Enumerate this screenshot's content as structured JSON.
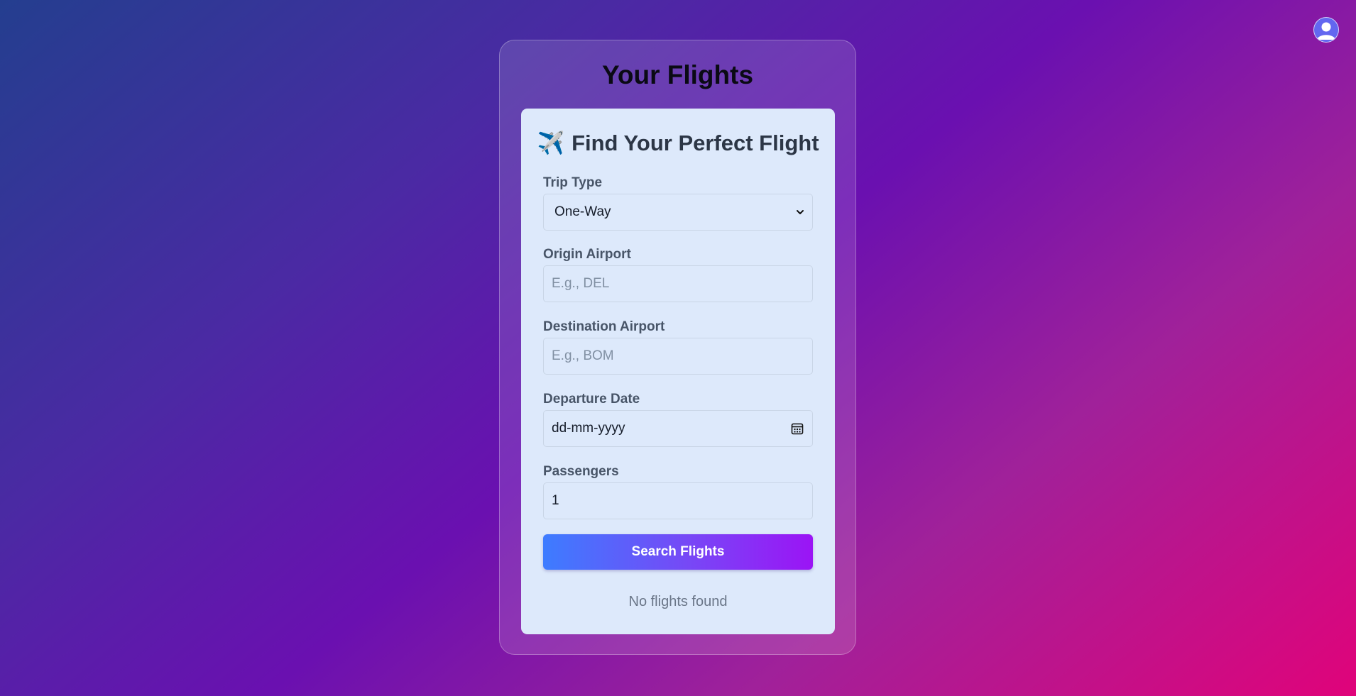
{
  "header": {
    "avatar_icon": "user-avatar-icon"
  },
  "page": {
    "title": "Your Flights"
  },
  "form": {
    "heading_icon": "✈️",
    "heading": "Find Your Perfect Flight",
    "trip_type": {
      "label": "Trip Type",
      "value": "One-Way"
    },
    "origin": {
      "label": "Origin Airport",
      "placeholder": "E.g., DEL"
    },
    "destination": {
      "label": "Destination Airport",
      "placeholder": "E.g., BOM"
    },
    "departure": {
      "label": "Departure Date",
      "value": "dd-mm-yyyy",
      "icon": "calendar-icon"
    },
    "passengers": {
      "label": "Passengers",
      "value": "1"
    },
    "search_button": "Search Flights"
  },
  "results": {
    "empty_message": "No flights found"
  },
  "colors": {
    "button_gradient_start": "#3d7cff",
    "button_gradient_end": "#9b14f5",
    "card_background": "#dde9fb"
  }
}
